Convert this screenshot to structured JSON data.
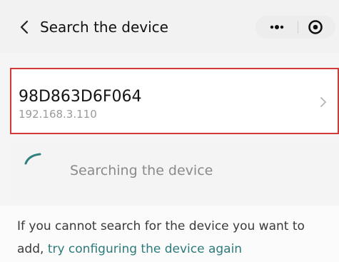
{
  "header": {
    "title": "Search the device",
    "back_icon": "chevron-left-icon",
    "more_icon": "more-dots-icon",
    "target_icon": "target-icon"
  },
  "device": {
    "name": "98D863D6F064",
    "ip": "192.168.3.110",
    "chevron_icon": "chevron-right-icon",
    "highlight_color": "#d23a3a"
  },
  "status": {
    "text": "Searching the device",
    "spinner_color": "#2f7f7a"
  },
  "hint": {
    "line1": "If you cannot search for the device you want to",
    "line2_prefix": "add,",
    "link_text": "try configuring the device again",
    "link_color": "#2c7a7b"
  }
}
